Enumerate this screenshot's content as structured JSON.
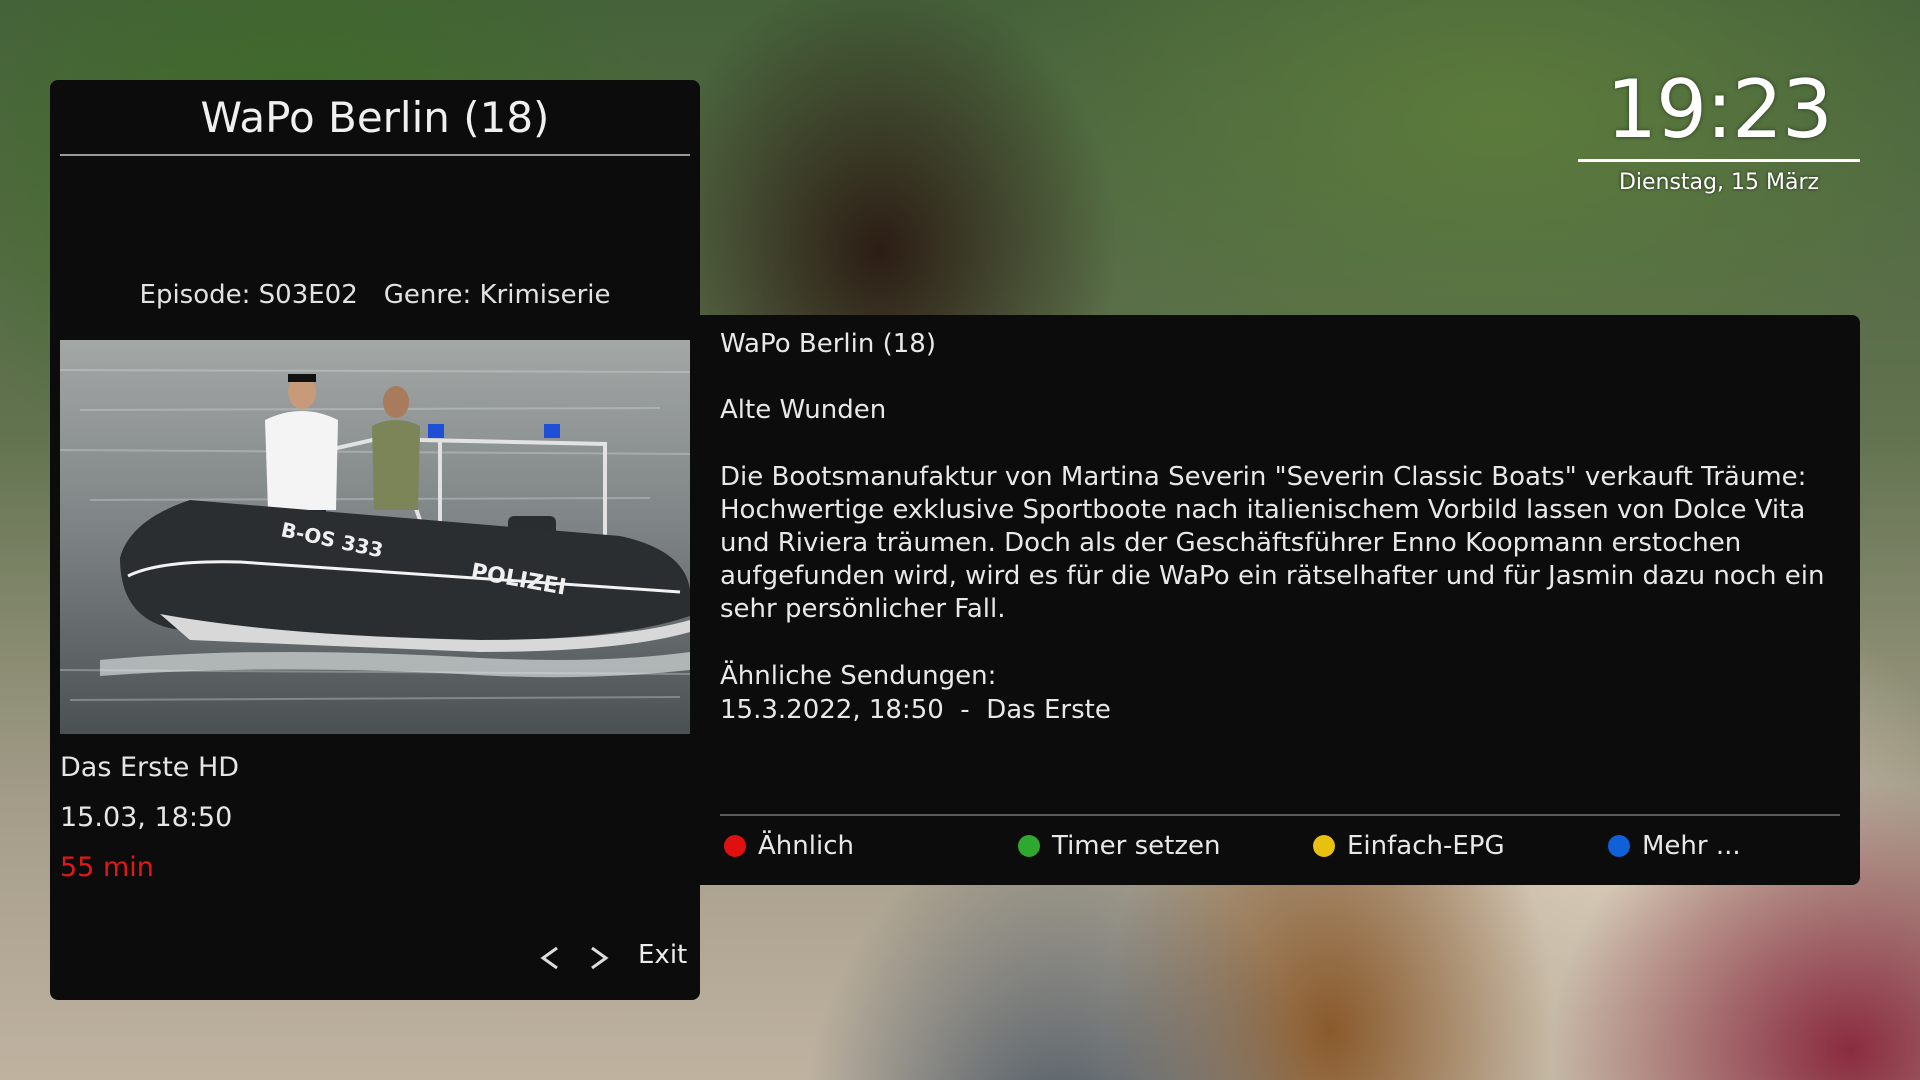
{
  "left_panel": {
    "title": "WaPo Berlin (18)",
    "episode": "Episode: S03E02",
    "genre": "Genre: Krimiserie",
    "channel": "Das Erste HD",
    "air_time": "15.03, 18:50",
    "duration": "55 min",
    "nav_prev_icon": "chevron-left-icon",
    "nav_next_icon": "chevron-right-icon",
    "exit_label": "Exit",
    "preview_boat_labels": {
      "registration": "B-OS 333",
      "police": "POLIZEI"
    }
  },
  "description": {
    "title": "WaPo Berlin (18)",
    "subtitle": "Alte Wunden",
    "body": "Die Bootsmanufaktur von Martina Severin \"Severin Classic Boats\" verkauft Träume: Hochwertige exklusive Sportboote nach italienischem Vorbild lassen von Dolce Vita und Riviera träumen. Doch als der Geschäftsführer Enno Koopmann erstochen aufgefunden wird, wird es für die WaPo ein rätselhafter und für Jasmin dazu noch ein sehr persönlicher Fall.",
    "similar_heading": "Ähnliche Sendungen:",
    "similar_entry": "15.3.2022, 18:50  -  Das Erste"
  },
  "buttons": {
    "red": {
      "label": "Ähnlich",
      "color": "#e01010"
    },
    "green": {
      "label": "Timer setzen",
      "color": "#2ea82e"
    },
    "yellow": {
      "label": "Einfach-EPG",
      "color": "#e8c010"
    },
    "blue": {
      "label": "Mehr ...",
      "color": "#1060d8"
    }
  },
  "clock": {
    "time": "19:23",
    "date": "Dienstag, 15 März"
  },
  "colors": {
    "panel_bg": "#0c0c0c",
    "accent_duration": "#e01818"
  }
}
